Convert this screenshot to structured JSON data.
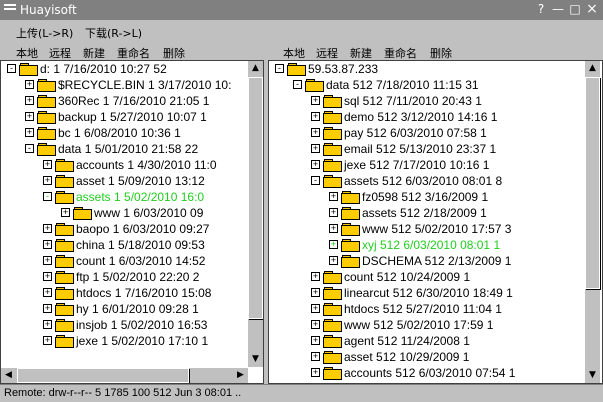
{
  "window": {
    "title": "Huayisoft",
    "help": "?",
    "minimize": "—",
    "maximize": "□",
    "close": "×"
  },
  "menu": {
    "upload": "上传(L->R)",
    "download": "下载(R->L)"
  },
  "left": {
    "toolbar": {
      "local": "本地",
      "remote": "远程",
      "new": "新建",
      "rename": "重命名",
      "delete": "删除"
    },
    "rows": [
      {
        "level": 0,
        "exp": "-",
        "open": true,
        "text": "d:              1   7/16/2010 10:27 52"
      },
      {
        "level": 1,
        "exp": "+",
        "text": "$RECYCLE.BIN    1   3/17/2010 10:"
      },
      {
        "level": 1,
        "exp": "+",
        "text": "360Rec     1   7/16/2010 21:05 1"
      },
      {
        "level": 1,
        "exp": "+",
        "text": "backup     1   5/27/2010 10:07 1"
      },
      {
        "level": 1,
        "exp": "+",
        "text": "bc     1   6/08/2010 10:36 1"
      },
      {
        "level": 1,
        "exp": "-",
        "open": true,
        "text": "data     1   5/01/2010 21:58 22"
      },
      {
        "level": 2,
        "exp": "+",
        "text": "accounts     1   4/30/2010 11:0"
      },
      {
        "level": 2,
        "exp": "+",
        "text": "asset     1   5/09/2010 13:12"
      },
      {
        "level": 2,
        "exp": "-",
        "open": true,
        "sel": true,
        "text": "assets     1   5/02/2010 16:0"
      },
      {
        "level": 3,
        "exp": "+",
        "text": "www          1   6/03/2010 09"
      },
      {
        "level": 2,
        "exp": "+",
        "text": "baopo     1   6/03/2010 09:27"
      },
      {
        "level": 2,
        "exp": "+",
        "text": "china     1   5/18/2010 09:53"
      },
      {
        "level": 2,
        "exp": "+",
        "text": "count     1   6/03/2010 14:52"
      },
      {
        "level": 2,
        "exp": "+",
        "text": "ftp     1   5/02/2010 22:20 2"
      },
      {
        "level": 2,
        "exp": "+",
        "text": "htdocs     1   7/16/2010 15:08"
      },
      {
        "level": 2,
        "exp": "+",
        "text": "hy     1   6/01/2010 09:28 1"
      },
      {
        "level": 2,
        "exp": "+",
        "text": "insjob     1   5/02/2010 16:53"
      },
      {
        "level": 2,
        "exp": "+",
        "text": "jexe     1   5/02/2010 17:10 1"
      }
    ]
  },
  "right": {
    "toolbar": {
      "local": "本地",
      "remote": "远程",
      "new": "新建",
      "rename": "重命名",
      "delete": "删除"
    },
    "rows": [
      {
        "level": 0,
        "exp": "-",
        "open": true,
        "text": "59.53.87.233"
      },
      {
        "level": 1,
        "exp": "-",
        "open": true,
        "text": "data     512   7/18/2010 11:15 31"
      },
      {
        "level": 2,
        "exp": "+",
        "text": "sql     512   7/11/2010 20:43 1"
      },
      {
        "level": 2,
        "exp": "+",
        "text": "demo     512   3/12/2010 14:16 1"
      },
      {
        "level": 2,
        "exp": "+",
        "text": "pay     512   6/03/2010 07:58 1"
      },
      {
        "level": 2,
        "exp": "+",
        "text": "email     512   5/13/2010 23:37 1"
      },
      {
        "level": 2,
        "exp": "+",
        "text": "jexe     512   7/17/2010 10:16 1"
      },
      {
        "level": 2,
        "exp": "-",
        "open": true,
        "text": "assets     512   6/03/2010 08:01 8"
      },
      {
        "level": 3,
        "exp": "+",
        "text": "fz0598     512   3/16/2009     1"
      },
      {
        "level": 3,
        "exp": "+",
        "text": "assets     512   2/18/2009     1"
      },
      {
        "level": 3,
        "exp": "+",
        "text": "www     512   5/02/2010 17:57 3"
      },
      {
        "level": 3,
        "exp": "+",
        "sel": true,
        "text": "xyj     512   6/03/2010 08:01 1"
      },
      {
        "level": 3,
        "exp": "+",
        "text": "DSCHEMA     512   2/13/2009     1"
      },
      {
        "level": 2,
        "exp": "+",
        "text": "count     512  10/24/2009     1"
      },
      {
        "level": 2,
        "exp": "+",
        "text": "linearcut     512   6/30/2010 18:49 1"
      },
      {
        "level": 2,
        "exp": "+",
        "text": "htdocs     512   5/27/2010 11:04 1"
      },
      {
        "level": 2,
        "exp": "+",
        "text": "www     512   5/02/2010 17:59 1"
      },
      {
        "level": 2,
        "exp": "+",
        "text": "agent     512  11/24/2008     1"
      },
      {
        "level": 2,
        "exp": "+",
        "text": "asset     512  10/29/2009     1"
      },
      {
        "level": 2,
        "exp": "+",
        "text": "accounts     512   6/03/2010 07:54 1"
      }
    ]
  },
  "status": "Remote: drw-r--r--    5 1785  100       512 Jun  3 08:01 .."
}
